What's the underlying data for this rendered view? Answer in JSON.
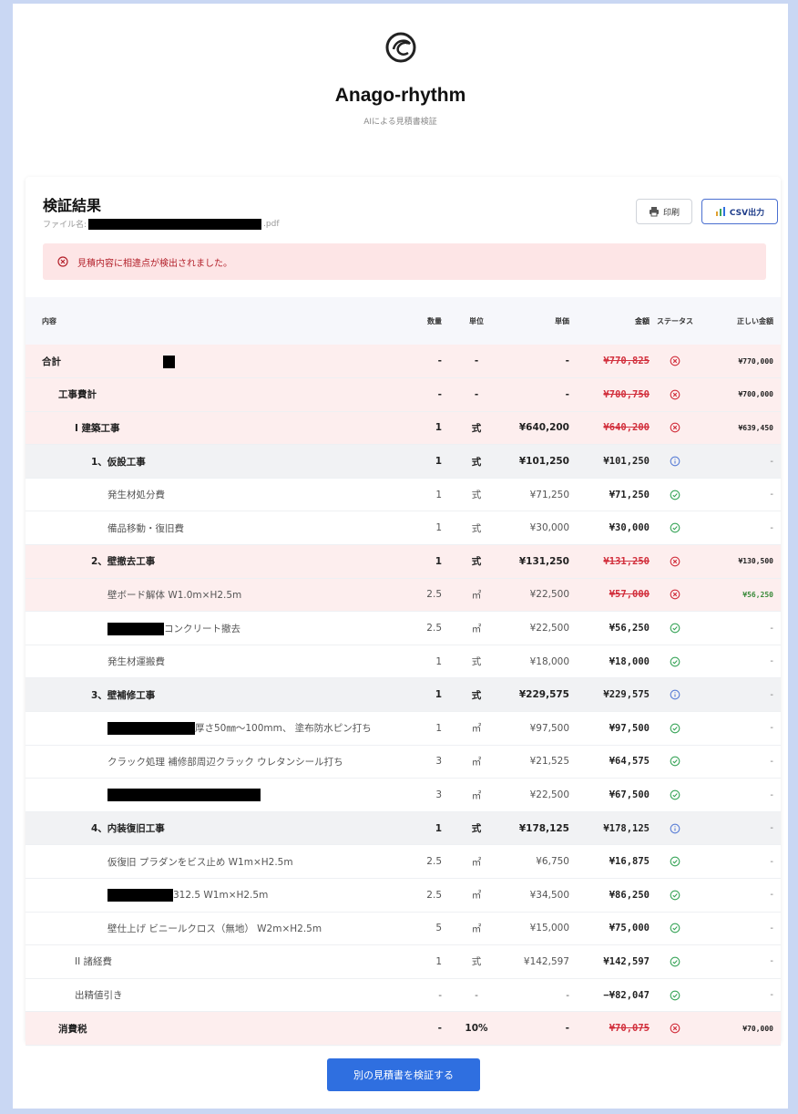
{
  "app": {
    "title": "Anago-rhythm",
    "subtitle": "AIによる見積書検証"
  },
  "result": {
    "title": "検証結果",
    "file_label": "ファイル名:",
    "file_ext": ".pdf",
    "print_label": "印刷",
    "csv_label": "CSV出力",
    "alert_text": "見積内容に相違点が検出されました。"
  },
  "table": {
    "headers": {
      "name": "内容",
      "qty": "数量",
      "unit": "単位",
      "price": "単価",
      "amount": "金額",
      "status": "ステータス",
      "correct": "正しい金額"
    },
    "rows": [
      {
        "name": "合計",
        "level": 0,
        "qty": "-",
        "unit": "-",
        "price": "-",
        "amount": "¥770,825",
        "status": "error",
        "correct": "¥770,000",
        "bold": true,
        "bg": "error"
      },
      {
        "name": "工事費計",
        "level": 1,
        "qty": "-",
        "unit": "-",
        "price": "-",
        "amount": "¥700,750",
        "status": "error",
        "correct": "¥700,000",
        "bold": true,
        "bg": "error"
      },
      {
        "name": "I 建築工事",
        "level": 2,
        "qty": "1",
        "unit": "式",
        "price": "¥640,200",
        "amount": "¥640,200",
        "status": "error",
        "correct": "¥639,450",
        "bold": true,
        "bg": "error"
      },
      {
        "name": "1、仮設工事",
        "level": 3,
        "qty": "1",
        "unit": "式",
        "price": "¥101,250",
        "amount": "¥101,250",
        "status": "info",
        "correct": "-",
        "bold": true,
        "bg": "group"
      },
      {
        "name": "発生材処分費",
        "level": 4,
        "qty": "1",
        "unit": "式",
        "price": "¥71,250",
        "amount": "¥71,250",
        "status": "ok",
        "correct": "-",
        "bold": false,
        "bg": "none"
      },
      {
        "name": "備品移動・復旧費",
        "level": 4,
        "qty": "1",
        "unit": "式",
        "price": "¥30,000",
        "amount": "¥30,000",
        "status": "ok",
        "correct": "-",
        "bold": false,
        "bg": "none"
      },
      {
        "name": "2、壁撤去工事",
        "level": 3,
        "qty": "1",
        "unit": "式",
        "price": "¥131,250",
        "amount": "¥131,250",
        "status": "error",
        "correct": "¥130,500",
        "bold": true,
        "bg": "error"
      },
      {
        "name": "壁ボード解体 W1.0m×H2.5m",
        "level": 4,
        "qty": "2.5",
        "unit": "㎡",
        "price": "¥22,500",
        "amount": "¥57,000",
        "status": "error",
        "correct": "¥56,250",
        "bold": false,
        "bg": "error"
      },
      {
        "name": "コンクリート撤去",
        "level": 4,
        "qty": "2.5",
        "unit": "㎡",
        "price": "¥22,500",
        "amount": "¥56,250",
        "status": "ok",
        "correct": "-",
        "bold": false,
        "bg": "none",
        "redact_prefix": 62
      },
      {
        "name": "発生材運搬費",
        "level": 4,
        "qty": "1",
        "unit": "式",
        "price": "¥18,000",
        "amount": "¥18,000",
        "status": "ok",
        "correct": "-",
        "bold": false,
        "bg": "none"
      },
      {
        "name": "3、壁補修工事",
        "level": 3,
        "qty": "1",
        "unit": "式",
        "price": "¥229,575",
        "amount": "¥229,575",
        "status": "info",
        "correct": "-",
        "bold": true,
        "bg": "group"
      },
      {
        "name": "厚さ50㎜～100mm、 塗布防水ピン打ち",
        "level": 4,
        "qty": "1",
        "unit": "㎡",
        "price": "¥97,500",
        "amount": "¥97,500",
        "status": "ok",
        "correct": "-",
        "bold": false,
        "bg": "none",
        "redact_prefix": 96
      },
      {
        "name": "クラック処理 補修部周辺クラック ウレタンシール打ち",
        "level": 4,
        "qty": "3",
        "unit": "㎡",
        "price": "¥21,525",
        "amount": "¥64,575",
        "status": "ok",
        "correct": "-",
        "bold": false,
        "bg": "none"
      },
      {
        "name": "",
        "level": 4,
        "qty": "3",
        "unit": "㎡",
        "price": "¥22,500",
        "amount": "¥67,500",
        "status": "ok",
        "correct": "-",
        "bold": false,
        "bg": "none",
        "redact_prefix": 168
      },
      {
        "name": "4、内装復旧工事",
        "level": 3,
        "qty": "1",
        "unit": "式",
        "price": "¥178,125",
        "amount": "¥178,125",
        "status": "info",
        "correct": "-",
        "bold": true,
        "bg": "group"
      },
      {
        "name": "仮復旧 プラダンをビス止め W1m×H2.5m",
        "level": 4,
        "qty": "2.5",
        "unit": "㎡",
        "price": "¥6,750",
        "amount": "¥16,875",
        "status": "ok",
        "correct": "-",
        "bold": false,
        "bg": "none"
      },
      {
        "name": "312.5 W1m×H2.5m",
        "level": 4,
        "qty": "2.5",
        "unit": "㎡",
        "price": "¥34,500",
        "amount": "¥86,250",
        "status": "ok",
        "correct": "-",
        "bold": false,
        "bg": "none",
        "redact_prefix": 72
      },
      {
        "name": "壁仕上げ ビニールクロス（無地） W2m×H2.5m",
        "level": 4,
        "qty": "5",
        "unit": "㎡",
        "price": "¥15,000",
        "amount": "¥75,000",
        "status": "ok",
        "correct": "-",
        "bold": false,
        "bg": "none"
      },
      {
        "name": "II 諸経費",
        "level": 2,
        "qty": "1",
        "unit": "式",
        "price": "¥142,597",
        "amount": "¥142,597",
        "status": "ok",
        "correct": "-",
        "bold": false,
        "bg": "none"
      },
      {
        "name": "出精値引き",
        "level": 2,
        "qty": "-",
        "unit": "-",
        "price": "-",
        "amount": "−¥82,047",
        "status": "ok",
        "correct": "-",
        "bold": false,
        "bg": "none"
      },
      {
        "name": "消費税",
        "level": 1,
        "qty": "-",
        "unit": "10%",
        "price": "-",
        "amount": "¥70,075",
        "status": "error",
        "correct": "¥70,000",
        "bold": true,
        "bg": "error"
      }
    ]
  },
  "footer": {
    "verify_button": "別の見積書を検証する"
  },
  "colors": {
    "accent": "#2f6fe0",
    "error": "#d2303d",
    "ok": "#3aa55a",
    "info": "#5b7fd6"
  }
}
